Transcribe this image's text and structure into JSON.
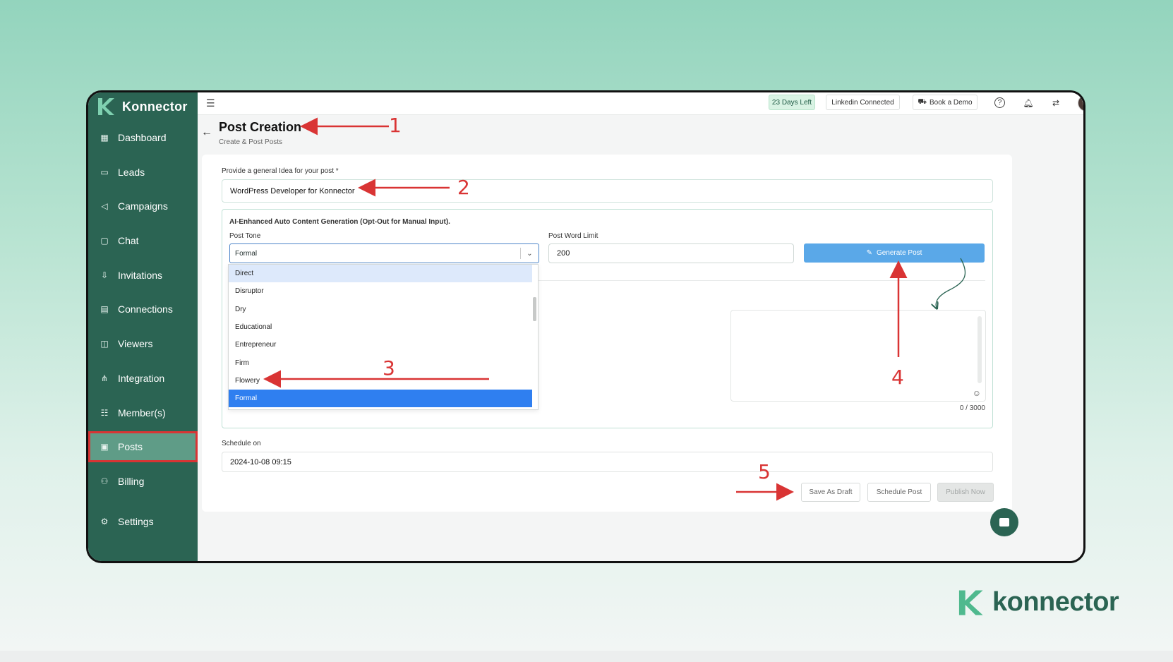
{
  "app": {
    "brand": "Konnector",
    "logo_text": "konnector"
  },
  "sidebar": {
    "items": [
      {
        "label": "Dashboard",
        "icon": "dashboard-icon"
      },
      {
        "label": "Leads",
        "icon": "leads-icon"
      },
      {
        "label": "Campaigns",
        "icon": "megaphone-icon"
      },
      {
        "label": "Chat",
        "icon": "chat-icon"
      },
      {
        "label": "Invitations",
        "icon": "invitation-icon"
      },
      {
        "label": "Connections",
        "icon": "connections-icon"
      },
      {
        "label": "Viewers",
        "icon": "viewers-icon"
      },
      {
        "label": "Integration",
        "icon": "integration-icon"
      },
      {
        "label": "Member(s)",
        "icon": "members-icon"
      },
      {
        "label": "Posts",
        "icon": "posts-icon",
        "active": true
      },
      {
        "label": "Billing",
        "icon": "billing-icon"
      }
    ],
    "settings_label": "Settings"
  },
  "topbar": {
    "days_left": "23 Days Left",
    "linkedin_status": "Linkedin Connected",
    "book_demo": "Book a Demo"
  },
  "page": {
    "title": "Post Creation",
    "subtitle": "Create & Post Posts"
  },
  "form": {
    "idea_label": "Provide a general Idea for your post *",
    "idea_value": "WordPress Developer for Konnector",
    "ai_title": "AI-Enhanced Auto Content Generation (Opt-Out for Manual Input).",
    "tone_label": "Post Tone",
    "tone_value": "Formal",
    "word_limit_label": "Post Word Limit",
    "word_limit_value": "200",
    "generate_label": "Generate Post",
    "char_counter": "0 / 3000",
    "schedule_label": "Schedule on",
    "schedule_value": "2024-10-08 09:15",
    "save_draft_label": "Save As Draft",
    "schedule_post_label": "Schedule Post",
    "publish_label": "Publish Now"
  },
  "tone_options": [
    "Direct",
    "Disruptor",
    "Dry",
    "Educational",
    "Entrepreneur",
    "Firm",
    "Flowery",
    "Formal"
  ],
  "tone_highlighted": "Direct",
  "tone_selected": "Formal",
  "annotations": [
    "1",
    "2",
    "3",
    "4",
    "5"
  ],
  "colors": {
    "brand_green": "#2b6453",
    "active_nav": "#5f9c87",
    "annotation_red": "#d93434",
    "generate_blue": "#5aa8e8",
    "selected_option": "#2f7ff0"
  }
}
